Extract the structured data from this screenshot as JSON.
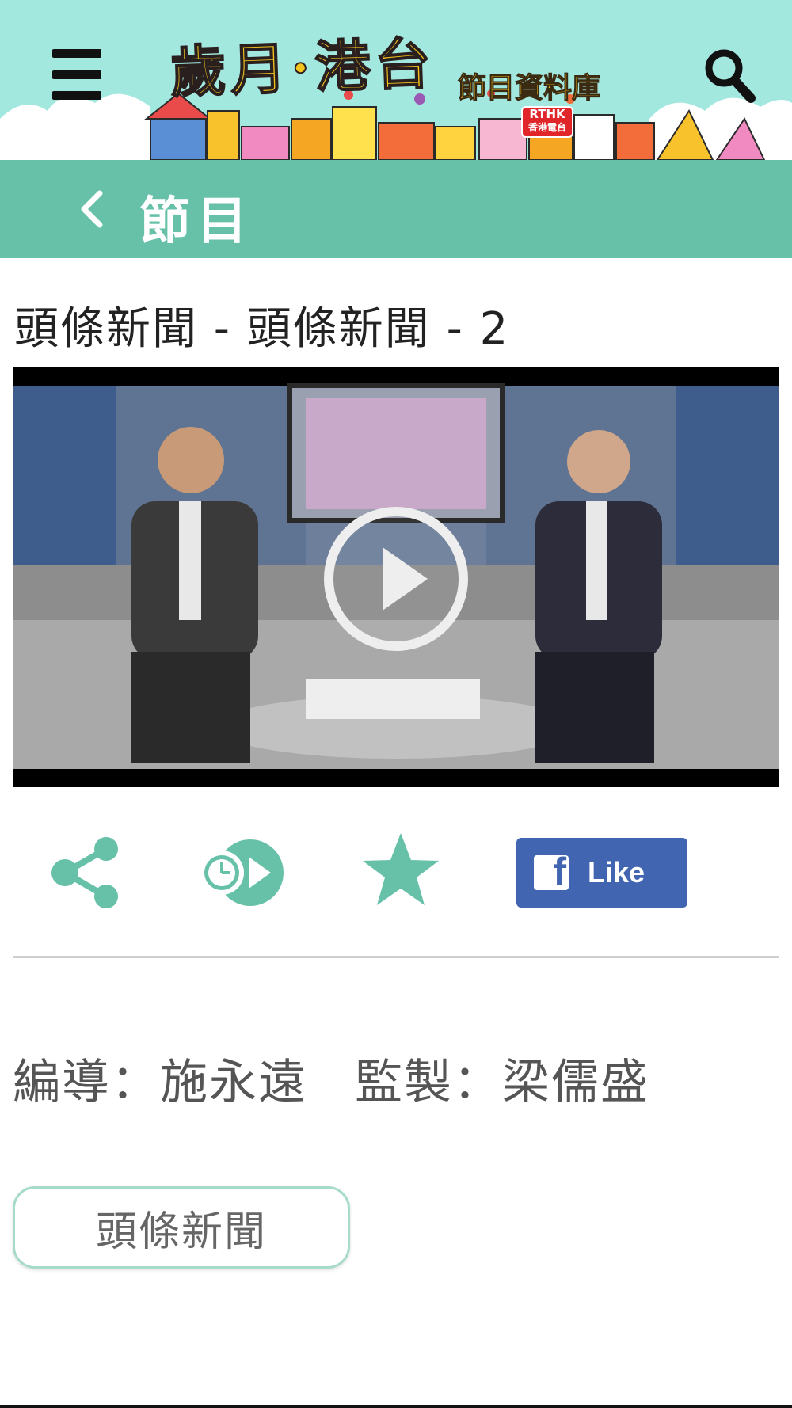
{
  "header": {
    "logo_title": "歲月·港台",
    "logo_subtitle": "節目資料庫",
    "badge_line1": "RTHK",
    "badge_line2": "香港電台",
    "menu_icon": "hamburger-menu-icon",
    "search_icon": "search-icon",
    "banner_color": "#a3e8df"
  },
  "section": {
    "title": "節目",
    "back_icon": "chevron-left-icon",
    "color": "#66c1a8"
  },
  "episode": {
    "title": "頭條新聞 - 頭條新聞 - 2"
  },
  "video": {
    "play_icon": "play-circle-icon"
  },
  "actions": {
    "share_icon": "share-icon",
    "watch_later_icon": "watch-later-icon",
    "favorite_icon": "star-icon",
    "facebook_like_label": "Like",
    "accent_color": "#66c1a8",
    "facebook_color": "#4265b1"
  },
  "credits": {
    "director_label": "編導：",
    "director_name": "施永遠",
    "producer_label": "監製：",
    "producer_name": "梁儒盛"
  },
  "tags": [
    {
      "label": "頭條新聞"
    }
  ]
}
